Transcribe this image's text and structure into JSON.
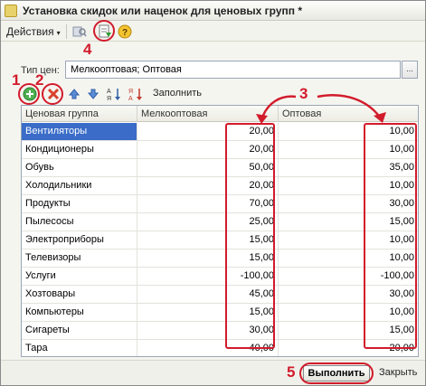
{
  "window": {
    "title": "Установка скидок или наценок для ценовых групп *"
  },
  "toolbar": {
    "actions_label": "Действия",
    "caret": "▾"
  },
  "price_type": {
    "label": "Тип цен:",
    "value": "Мелкооптовая; Оптовая",
    "select_glyph": "..."
  },
  "gridbar": {
    "fill_label": "Заполнить"
  },
  "grid": {
    "columns": [
      "Ценовая группа",
      "Мелкооптовая",
      "Оптовая"
    ],
    "rows": [
      [
        "Вентиляторы",
        "20,00",
        "10,00"
      ],
      [
        "Кондиционеры",
        "20,00",
        "10,00"
      ],
      [
        "Обувь",
        "50,00",
        "35,00"
      ],
      [
        "Холодильники",
        "20,00",
        "10,00"
      ],
      [
        "Продукты",
        "70,00",
        "30,00"
      ],
      [
        "Пылесосы",
        "25,00",
        "15,00"
      ],
      [
        "Электроприборы",
        "15,00",
        "10,00"
      ],
      [
        "Телевизоры",
        "15,00",
        "10,00"
      ],
      [
        "Услуги",
        "-100,00",
        "-100,00"
      ],
      [
        "Хозтовары",
        "45,00",
        "30,00"
      ],
      [
        "Компьютеры",
        "15,00",
        "10,00"
      ],
      [
        "Сигареты",
        "30,00",
        "15,00"
      ],
      [
        "Тара",
        "40,00",
        "20,00"
      ]
    ],
    "selected_row": 0
  },
  "footer": {
    "execute_label": "Выполнить",
    "close_label": "Закрыть"
  },
  "annotations": {
    "n1": "1",
    "n2": "2",
    "n3": "3",
    "n4": "4",
    "n5": "5"
  },
  "colors": {
    "annotation_red": "#d21b2b",
    "selection_blue": "#3a6cc8"
  }
}
